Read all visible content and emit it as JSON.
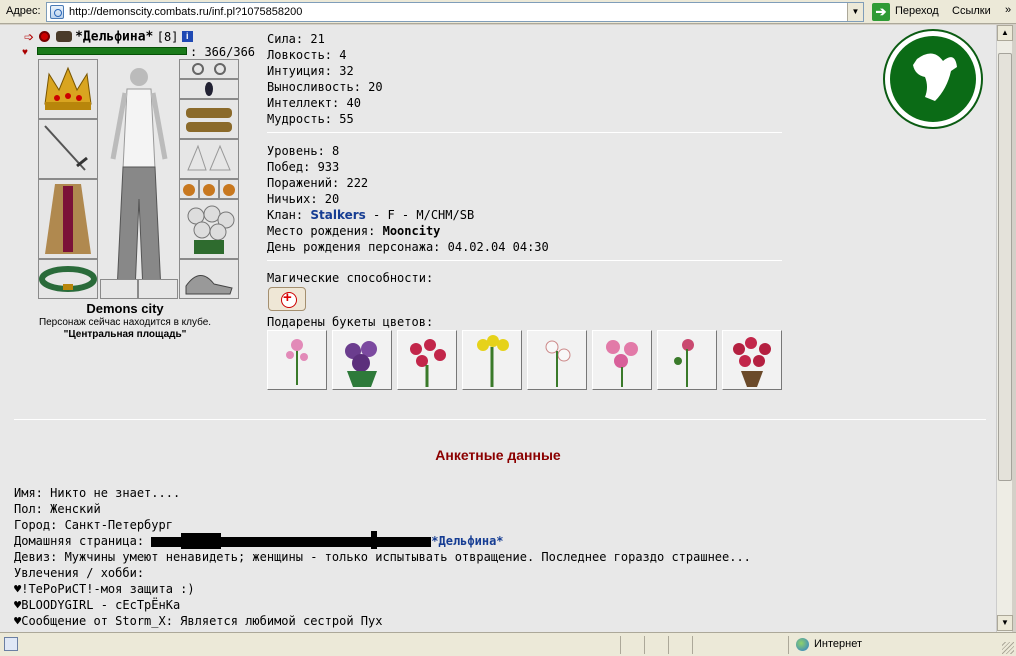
{
  "addressbar": {
    "label": "Адрес:",
    "url": "http://demonscity.combats.ru/inf.pl?1075858200",
    "go_label": "Переход",
    "links_label": "Ссылки",
    "links_chevron": "»"
  },
  "character": {
    "name": "*Дельфина*",
    "level": "[8]",
    "info_icon": "i",
    "hp_text": ": 366/366",
    "hp_fraction": 1.0,
    "city": "Demons city",
    "status": "Персонаж сейчас находится в клубе.",
    "location": "\"Центральная площадь\""
  },
  "stats": {
    "strength": "Сила: 21",
    "agility": "Ловкость: 4",
    "intuition": "Интуиция: 32",
    "endurance": "Выносливость: 20",
    "intellect": "Интеллект: 40",
    "wisdom": "Мудрость: 55"
  },
  "record": {
    "level": "Уровень: 8",
    "wins": "Побед: 933",
    "losses": "Поражений: 222",
    "draws": "Ничьих: 20",
    "clan_label": "Клан:",
    "clan_name": "Stalkers",
    "clan_tail": " - F - M/CHM/SB",
    "birthplace_label": "Место рождения:",
    "birthplace": "Mooncity",
    "birthday": "День рождения персонажа: 04.02.04 04:30"
  },
  "magic": {
    "label": "Магические способности:",
    "icon": "healing-scroll-icon"
  },
  "flowers": {
    "label": "Подарены букеты цветов:",
    "items": [
      "pink-lily-icon",
      "purple-roses-icon",
      "red-roses-icon",
      "yellow-tulips-icon",
      "white-lilies-icon",
      "pink-orchids-icon",
      "pink-rose-icon",
      "red-rose-bush-icon"
    ]
  },
  "emblem": {
    "icon": "goat-emblem-icon",
    "color": "#0b6b16"
  },
  "profile": {
    "section_title": "Анкетные данные",
    "name": "Имя: Никто не знает....",
    "gender": "Пол: Женский",
    "city": "Город: Санкт-Петербург",
    "homepage_label": "Домашняя страница: ",
    "homepage_link": "*Дельфина*",
    "motto": "Девиз: Мужчины умеют ненавидеть; женщины - только испытывать отвращение. Последнее гораздо страшнее...",
    "hobby_label": "Увлечения / хобби:",
    "hobby_lines": [
      "♥!ТеРоРиСТ!-моя защита :)",
      "♥BLOODYGIRL - сЕсТрЁнКа",
      "♥Сообщение от Storm_X: Является любимой сестрой Пух"
    ]
  },
  "statusbar": {
    "zone": "Интернет"
  }
}
